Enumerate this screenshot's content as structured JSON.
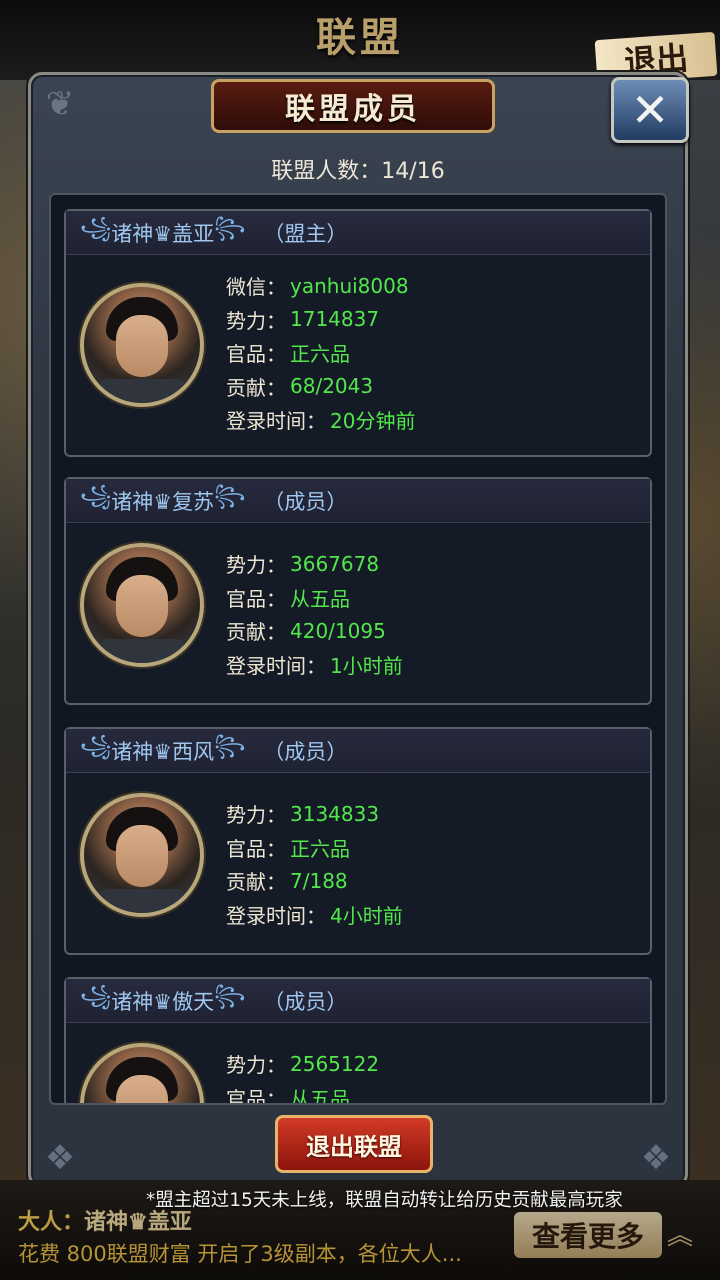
{
  "background": {
    "title": "联盟",
    "exit_label": "退出"
  },
  "dialog": {
    "title": "联盟成员",
    "close_icon": "close-icon",
    "member_count_label": "联盟人数：",
    "member_count_value": "14/16",
    "quit_button": "退出联盟"
  },
  "members": [
    {
      "name": "诸神♛盖亚",
      "role": "（盟主）",
      "fields": [
        {
          "label": "微信：",
          "value": "yanhui8008"
        },
        {
          "label": "势力：",
          "value": "1714837"
        },
        {
          "label": "官品：",
          "value": "正六品"
        },
        {
          "label": "贡献：",
          "value": "68/2043"
        },
        {
          "label": "登录时间：",
          "value": "20分钟前"
        }
      ]
    },
    {
      "name": "诸神♛复苏",
      "role": "（成员）",
      "fields": [
        {
          "label": "势力：",
          "value": "3667678"
        },
        {
          "label": "官品：",
          "value": "从五品"
        },
        {
          "label": "贡献：",
          "value": "420/1095"
        },
        {
          "label": "登录时间：",
          "value": "1小时前"
        }
      ]
    },
    {
      "name": "诸神♛西风",
      "role": "（成员）",
      "fields": [
        {
          "label": "势力：",
          "value": "3134833"
        },
        {
          "label": "官品：",
          "value": "正六品"
        },
        {
          "label": "贡献：",
          "value": "7/188"
        },
        {
          "label": "登录时间：",
          "value": "4小时前"
        }
      ]
    },
    {
      "name": "诸神♛傲天",
      "role": "（成员）",
      "fields": [
        {
          "label": "势力：",
          "value": "2565122"
        },
        {
          "label": "官品：",
          "value": "从五品"
        }
      ]
    }
  ],
  "footer": {
    "notice": "*盟主超过15天未上线，联盟自动转让给历史贡献最高玩家",
    "chat_prefix": "大人：",
    "chat_name": "诸神♛盖亚",
    "chat_message": "花费 800联盟财富 开启了3级副本，各位大人...",
    "more_button": "查看更多",
    "collapse_icon": "double-chevron-up-icon"
  },
  "colors": {
    "value_green": "#52e84b",
    "name_blue": "#9fc6ee",
    "quit_red": "#d23a25"
  }
}
